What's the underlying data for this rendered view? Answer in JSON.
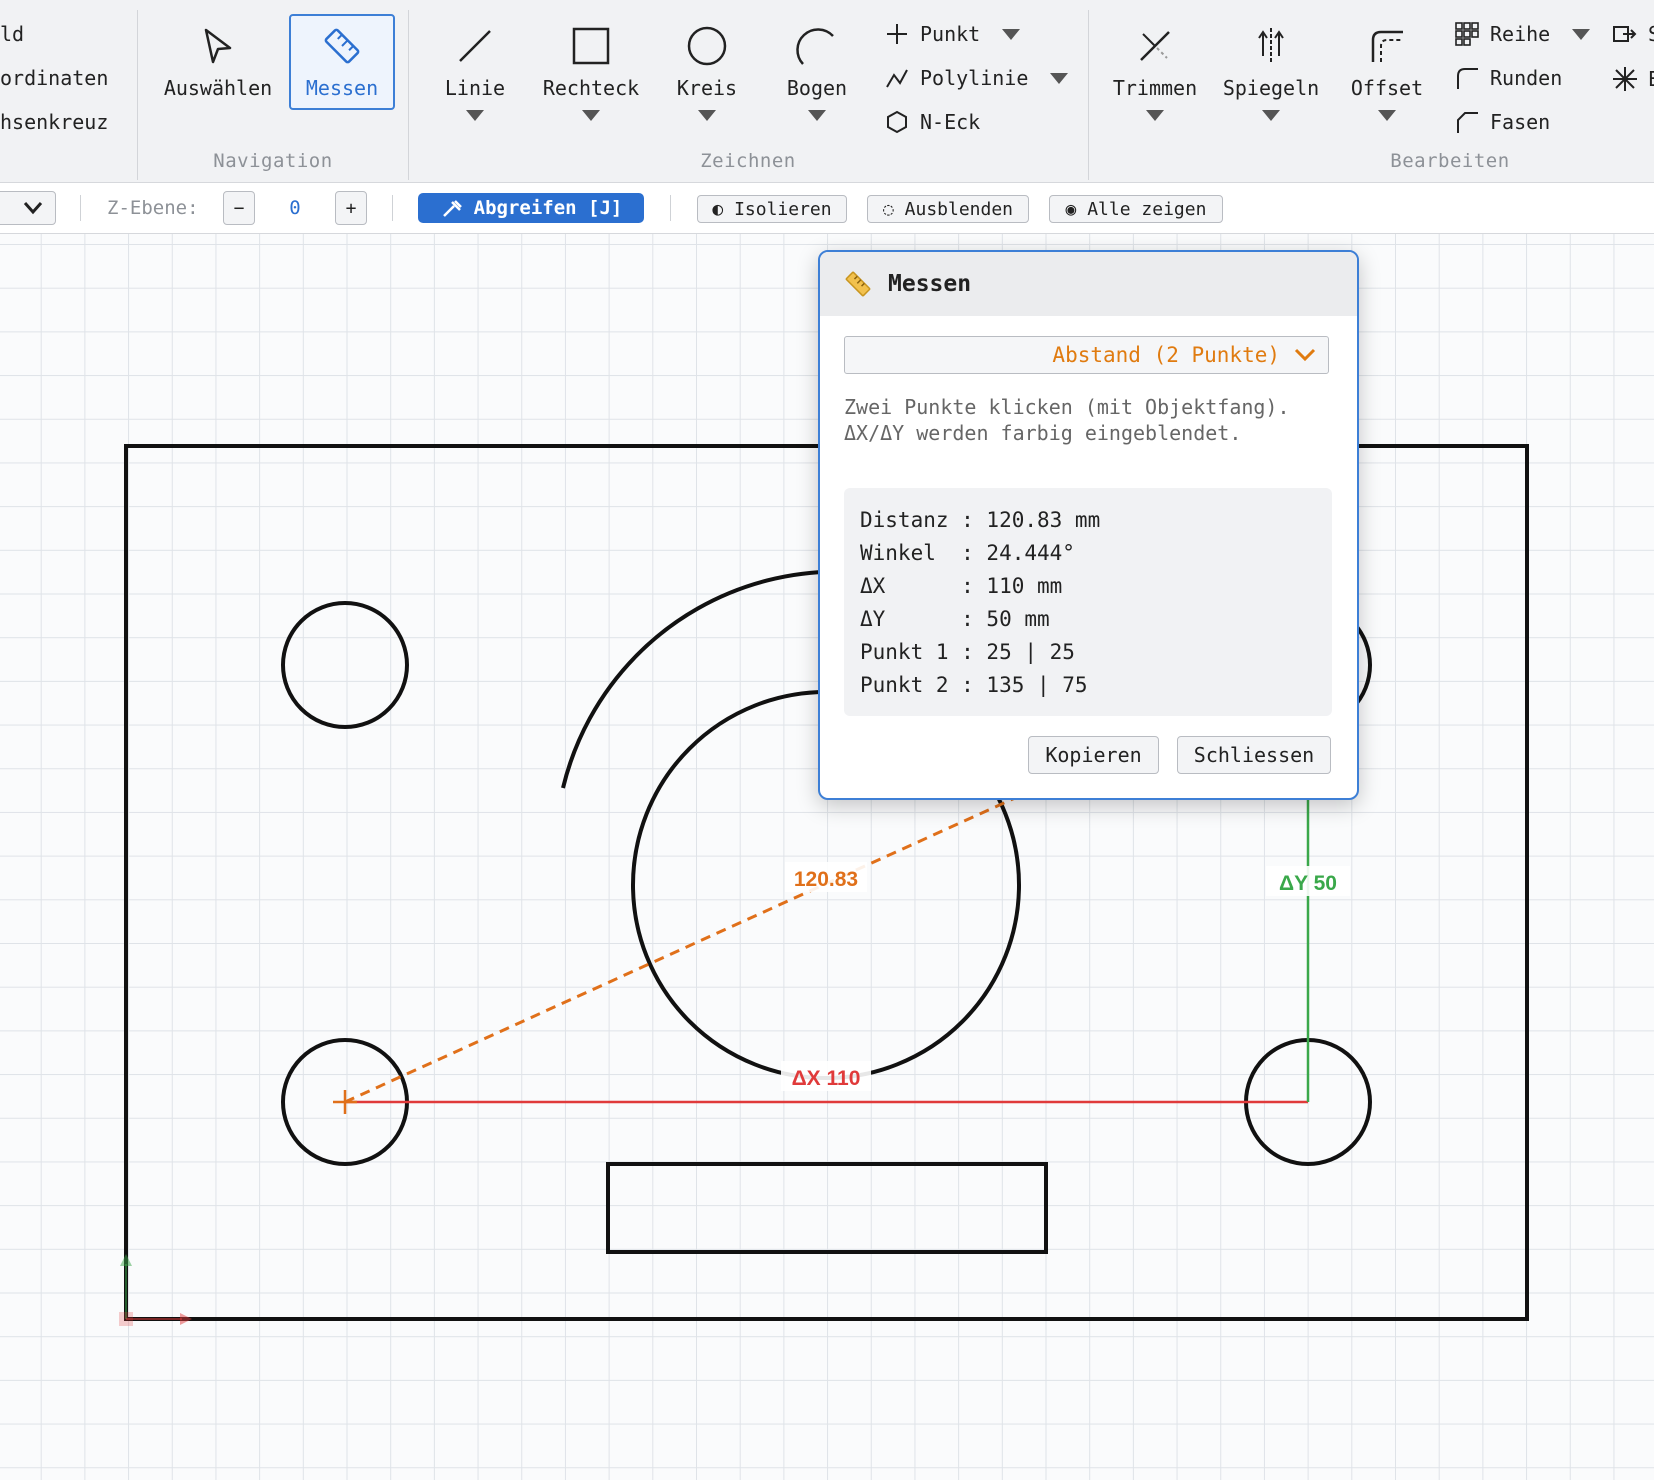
{
  "ribbon": {
    "left_cut": [
      "ld",
      "ordinaten",
      "hsenkreuz"
    ],
    "groups": {
      "navigation": "Navigation",
      "zeichnen": "Zeichnen",
      "bearbeiten": "Bearbeiten"
    },
    "navigation": {
      "select": "Auswählen",
      "measure": "Messen"
    },
    "zeichnen": {
      "line": "Linie",
      "rect": "Rechteck",
      "circle": "Kreis",
      "arc": "Bogen",
      "point": "Punkt",
      "polyline": "Polylinie",
      "ngon": "N-Eck"
    },
    "bearbeiten": {
      "trim": "Trimmen",
      "mirror": "Spiegeln",
      "offset": "Offset",
      "array": "Reihe",
      "fillet": "Runden",
      "chamfer": "Fasen",
      "cut1": "S",
      "cut2": "E"
    }
  },
  "toolbar": {
    "zlevel_label": "Z-Ebene:",
    "minus": "−",
    "zlevel_value": "0",
    "plus": "+",
    "pick": "Abgreifen [J]",
    "isolate": "◐ Isolieren",
    "hide": "◌ Ausblenden",
    "showall": "◉ Alle zeigen"
  },
  "canvas": {
    "dist_label": "120.83",
    "dx_label": "ΔX 110",
    "dy_label": "ΔY 50"
  },
  "dialog": {
    "title": "Messen",
    "mode": "Abstand (2 Punkte)",
    "description": "Zwei Punkte klicken (mit Objektfang). ΔX/ΔY werden farbig eingeblendet.",
    "results": "Distanz : 120.83 mm\nWinkel  : 24.444°\nΔX      : 110 mm\nΔY      : 50 mm\nPunkt 1 : 25 | 25\nPunkt 2 : 135 | 75",
    "copy": "Kopieren",
    "close": "Schliessen"
  },
  "colors": {
    "accent": "#3d7fd6",
    "distance": "#e0701a",
    "dx": "#e03a3a",
    "dy": "#3aa84a"
  }
}
